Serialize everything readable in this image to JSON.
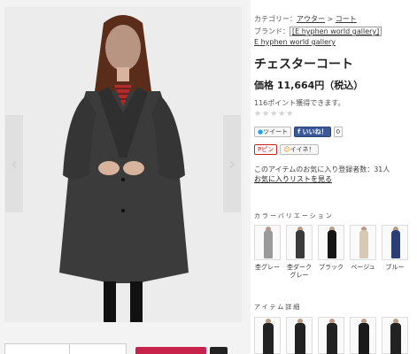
{
  "breadcrumb": {
    "label": "カテゴリー：",
    "items": [
      "アウター",
      "コート"
    ],
    "separator": ">"
  },
  "brand": {
    "label": "ブランド：",
    "link_text": "[E hyphen world gallery]",
    "sub_link": "E hyphen world gallery"
  },
  "product": {
    "title": "チェスターコート",
    "price": "価格 11,664円（税込）",
    "points": "116ポイント獲得できます。",
    "stars": "★★★★★"
  },
  "social": {
    "tweet": "ツイート",
    "like": "いいね！",
    "like_count": "0",
    "pin": "ピン",
    "iine": "イイネ！"
  },
  "favorites": {
    "count_text": "このアイテムのお気に入り登録者数：31人",
    "list_link": "お気に入りリストを見る"
  },
  "color_section": {
    "title": "カラーバリエーション",
    "colors": [
      {
        "name": "杢グレー",
        "hex": "#9a9a9a"
      },
      {
        "name": "杢ダークグレー",
        "hex": "#3a3a3a"
      },
      {
        "name": "ブラック",
        "hex": "#151515"
      },
      {
        "name": "ベージュ",
        "hex": "#d8c9b4"
      },
      {
        "name": "ブルー",
        "hex": "#2a3f78"
      }
    ]
  },
  "detail_section": {
    "title": "アイテム詳細"
  },
  "icons": {
    "prev": "chevron-left-icon",
    "next": "chevron-right-icon"
  },
  "colors_ui": {
    "cart_button": "#c8234a",
    "facebook": "#3b5998",
    "pinterest": "#cb2027"
  }
}
